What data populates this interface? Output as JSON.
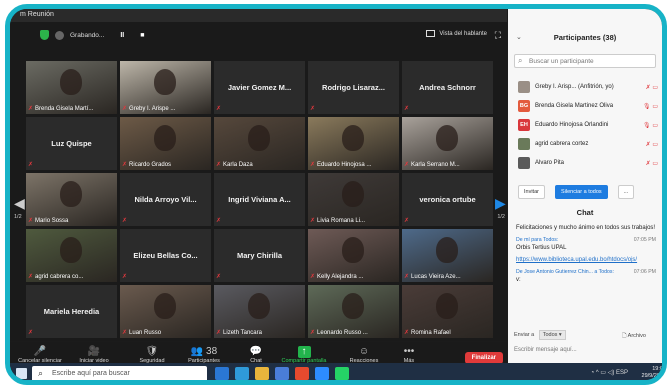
{
  "window": {
    "title": "m Reunión"
  },
  "topbar": {
    "recording": "Grabando...",
    "pause": "II",
    "stop": "■",
    "view": "Vista del hablante"
  },
  "tiles": [
    {
      "name": "Brenda Gisela Martí...",
      "type": "video",
      "row": 0,
      "col": 0,
      "color": "#6b6b63",
      "selected": true
    },
    {
      "name": "Greby I. Arispe ...",
      "type": "video",
      "row": 0,
      "col": 1,
      "color": "#bdb6a9"
    },
    {
      "name": "Javier Gomez M...",
      "type": "name",
      "row": 0,
      "col": 2
    },
    {
      "name": "Rodrigo Lisaraz...",
      "type": "name",
      "row": 0,
      "col": 3
    },
    {
      "name": "Andrea Schnorr",
      "type": "name",
      "row": 0,
      "col": 4
    },
    {
      "name": "Luz Quispe",
      "type": "name",
      "row": 1,
      "col": 0
    },
    {
      "name": "Ricardo Grados",
      "type": "video",
      "row": 1,
      "col": 1,
      "color": "#6d5a47"
    },
    {
      "name": "Karla Daza",
      "type": "video",
      "row": 1,
      "col": 2,
      "color": "#56483c"
    },
    {
      "name": "Eduardo Hinojosa ...",
      "type": "video",
      "row": 1,
      "col": 3,
      "color": "#8a7a5c"
    },
    {
      "name": "Karla Serrano M...",
      "type": "video",
      "row": 1,
      "col": 4,
      "color": "#a9a29b"
    },
    {
      "name": "Mario Sossa",
      "type": "video",
      "row": 2,
      "col": 0,
      "color": "#7d7468"
    },
    {
      "name": "Nilda Arroyo Vil...",
      "type": "name",
      "row": 2,
      "col": 1
    },
    {
      "name": "Ingrid Viviana A...",
      "type": "name",
      "row": 2,
      "col": 2
    },
    {
      "name": "Livia Romana Li...",
      "type": "video",
      "row": 2,
      "col": 3,
      "color": "#3f3a38"
    },
    {
      "name": "veronica ortube",
      "type": "name",
      "row": 2,
      "col": 4
    },
    {
      "name": "agrid cabrera co...",
      "type": "video",
      "row": 3,
      "col": 0,
      "color": "#4f5a3e"
    },
    {
      "name": "Elizeu Bellas Co...",
      "type": "name",
      "row": 3,
      "col": 1
    },
    {
      "name": "Mary Chirilla",
      "type": "name",
      "row": 3,
      "col": 2
    },
    {
      "name": "Kelly Alejandra ...",
      "type": "video",
      "row": 3,
      "col": 3,
      "color": "#6e5a56"
    },
    {
      "name": "Lucas Vieira Aze...",
      "type": "video",
      "row": 3,
      "col": 4,
      "color": "#4e6a8a"
    },
    {
      "name": "Mariela Heredia",
      "type": "name",
      "row": 4,
      "col": 0
    },
    {
      "name": "Luan Russo",
      "type": "video",
      "row": 4,
      "col": 1,
      "color": "#6a5a4e"
    },
    {
      "name": "Lizeth Tancara",
      "type": "video",
      "row": 4,
      "col": 2,
      "color": "#5a5a60"
    },
    {
      "name": "Leonardo Russo ...",
      "type": "video",
      "row": 4,
      "col": 3,
      "color": "#5e6a58"
    },
    {
      "name": "Romina Rafael",
      "type": "video",
      "row": 4,
      "col": 4,
      "color": "#4a3c38"
    }
  ],
  "pages": {
    "left": "1/2",
    "right": "1/2"
  },
  "toolbar": {
    "items": [
      {
        "label": "Cancelar silenciar ahora",
        "icon": "🎤"
      },
      {
        "label": "Iniciar video",
        "icon": "🎥"
      },
      {
        "label": "Seguridad",
        "icon": "🛡"
      },
      {
        "label": "Participantes",
        "icon": "👥",
        "count": "38"
      },
      {
        "label": "Chat",
        "icon": "💬"
      },
      {
        "label": "Compartir pantalla",
        "icon": "↑"
      },
      {
        "label": "Reacciones",
        "icon": "☺"
      },
      {
        "label": "Más",
        "icon": "•••"
      }
    ],
    "end": "Finalizar"
  },
  "participants_panel": {
    "title": "Participantes (38)",
    "search_placeholder": "Buscar un participante",
    "list": [
      {
        "name": "Greby I. Arisp... (Anfitrión, yo)",
        "initials": "",
        "color": "#9a8f86"
      },
      {
        "name": "Brenda Gisela Martinez Oliva",
        "initials": "BG",
        "color": "#e35b3e"
      },
      {
        "name": "Eduardo Hinojosa Orlandini",
        "initials": "EH",
        "color": "#d9373c"
      },
      {
        "name": "agrid cabrera cortez",
        "initials": "",
        "color": "#6a7a5a"
      },
      {
        "name": "Alvaro Pita",
        "initials": "",
        "color": "#5a5a5a"
      }
    ],
    "invite": "Invitar",
    "mute_all": "Silenciar a todos",
    "more": "..."
  },
  "chat": {
    "title": "Chat",
    "message1": "Felicitaciones y mucho ánimo en todos sus trabajos!",
    "meta2_from": "De mí para Todos:",
    "meta2_time": "07:05 PM",
    "message2": "Orbis Tertius UPAL",
    "link": "https://www.biblioteca.upal.edu.bo/htdocs/ojs/",
    "meta3_from": "De Jose Antonio Gutierrez Chin... a Todos:",
    "meta3_time": "07:06 PM",
    "message3": "v:",
    "send_to": "Enviar a",
    "todos": "Todos ▾",
    "file": "Archivo",
    "input_placeholder": "Escribir mensaje aquí..."
  },
  "taskbar": {
    "search": "Escribe aquí para buscar",
    "time": "19:08",
    "date": "29/9/2020",
    "lang": "ESP"
  }
}
